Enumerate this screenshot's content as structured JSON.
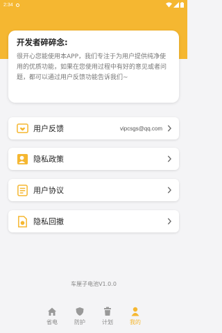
{
  "status_bar": {
    "time": "2:34"
  },
  "notice": {
    "title": "开发者碎碎念:",
    "body": "很开心您能使用本APP，我们专注于为用户提供纯净使用的优质功能，如果在您使用过程中有好的意见或者问题，都可以通过用户反馈功能告诉我们~"
  },
  "menu": [
    {
      "label": "用户反馈",
      "value": "vipcsgs@qq.com",
      "icon": "feedback-icon"
    },
    {
      "label": "隐私政策",
      "value": "",
      "icon": "privacy-policy-icon"
    },
    {
      "label": "用户协议",
      "value": "",
      "icon": "user-agreement-icon"
    },
    {
      "label": "隐私回撤",
      "value": "",
      "icon": "privacy-revoke-icon"
    }
  ],
  "app_version": "车厘子电池V1.0.0",
  "tabs": [
    {
      "label": "省电",
      "icon": "home-icon",
      "active": false
    },
    {
      "label": "防护",
      "icon": "shield-icon",
      "active": false
    },
    {
      "label": "计划",
      "icon": "trash-icon",
      "active": false
    },
    {
      "label": "我的",
      "icon": "person-icon",
      "active": true
    }
  ],
  "colors": {
    "accent": "#f5b731",
    "background": "#f4f4f6"
  }
}
